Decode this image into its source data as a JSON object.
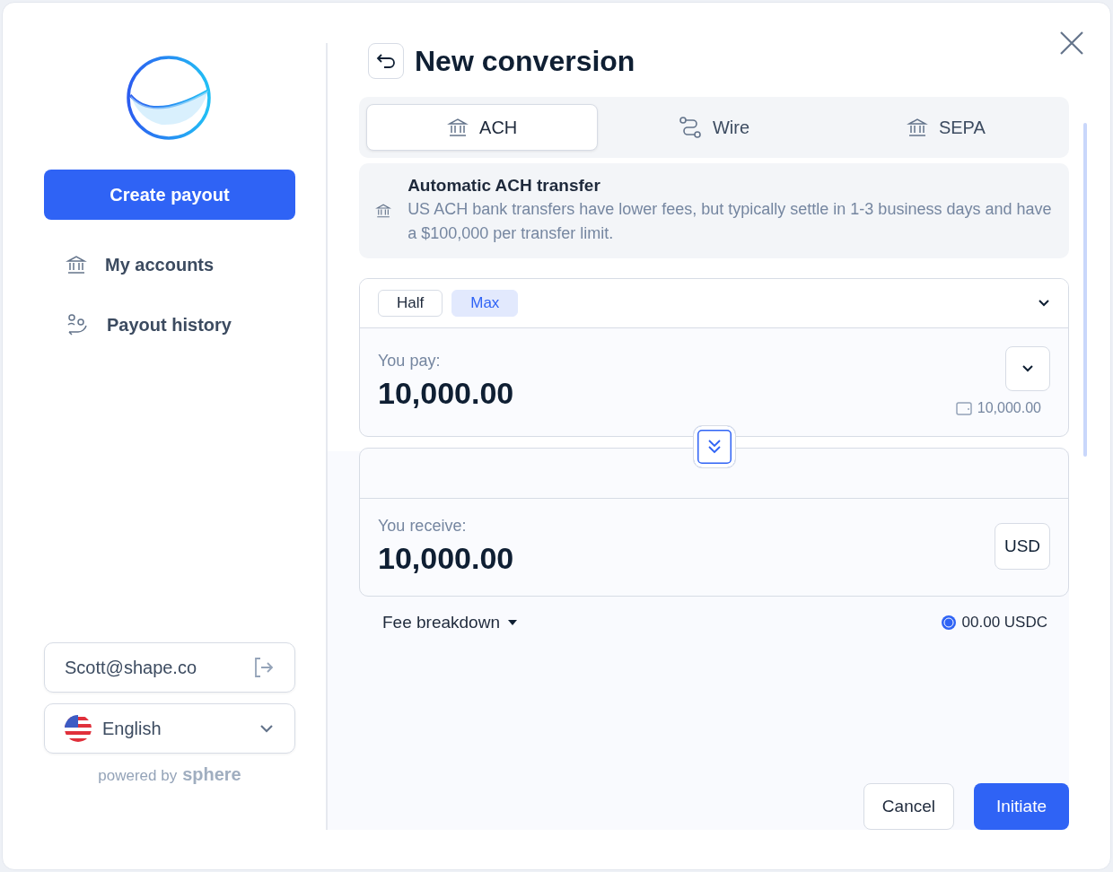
{
  "sidebar": {
    "primary_button": "Create payout",
    "nav": [
      {
        "label": "My accounts"
      },
      {
        "label": "Payout history"
      }
    ],
    "account": {
      "email": "Scott@shape.co"
    },
    "language": {
      "label": "English"
    },
    "powered_by": {
      "prefix": "powered by",
      "brand": "sphere"
    }
  },
  "header": {
    "title": "New conversion"
  },
  "tabs": [
    {
      "label": "ACH",
      "selected": true
    },
    {
      "label": "Wire",
      "selected": false
    },
    {
      "label": "SEPA",
      "selected": false
    }
  ],
  "info": {
    "title": "Automatic ACH transfer",
    "text": "US ACH bank transfers have lower fees, but typically settle in 1-3 business days and have a $100,000 per transfer limit."
  },
  "amount_presets": [
    {
      "label": "Half",
      "selected": false
    },
    {
      "label": "Max",
      "selected": true
    }
  ],
  "pay": {
    "label": "You pay:",
    "value": "10,000.00",
    "balance": "10,000.00"
  },
  "receive": {
    "label": "You receive:",
    "value": "10,000.00",
    "currency": "USD"
  },
  "fee": {
    "label": "Fee breakdown",
    "amount": "00.00 USDC"
  },
  "buttons": [
    {
      "label": "Cancel",
      "kind": "secondary"
    },
    {
      "label": "Initiate",
      "kind": "primary"
    }
  ]
}
